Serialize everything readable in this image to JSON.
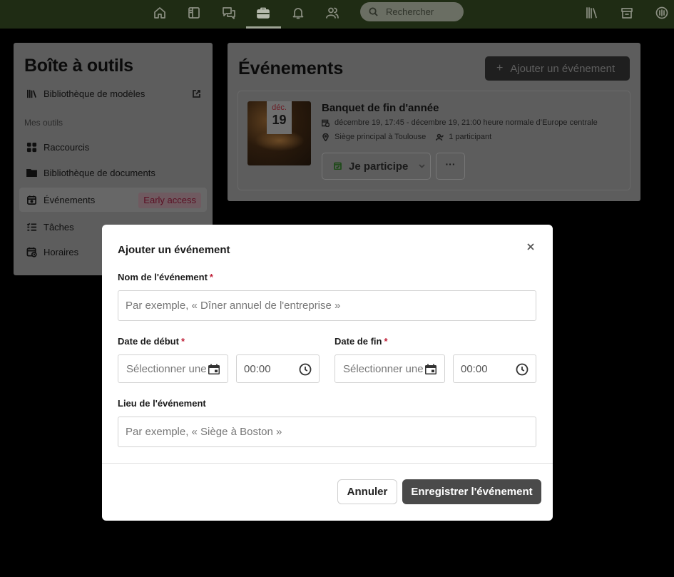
{
  "topbar": {
    "nav_icons": [
      "home-icon",
      "sidebar-icon",
      "chat-icon",
      "toolbox-icon",
      "bell-icon",
      "people-icon"
    ],
    "active_icon": "toolbox-icon",
    "search_placeholder": "Rechercher",
    "right_icons": [
      "library-icon",
      "store-icon",
      "settings-icon"
    ]
  },
  "sidebar": {
    "title": "Boîte à outils",
    "template_library": "Bibliothèque de modèles",
    "section_label": "Mes outils",
    "items": [
      {
        "label": "Raccourcis",
        "icon": "grid-icon"
      },
      {
        "label": "Bibliothèque de documents",
        "icon": "folder-icon"
      },
      {
        "label": "Événements",
        "icon": "calendar-icon",
        "badge": "Early access"
      },
      {
        "label": "Tâches",
        "icon": "checklist-icon"
      },
      {
        "label": "Horaires",
        "icon": "schedule-icon"
      }
    ]
  },
  "events": {
    "title": "Événements",
    "add_button": "Ajouter un événement",
    "card": {
      "month": "déc.",
      "day": "19",
      "name": "Banquet de fin d'année",
      "time": "décembre 19, 17:45 - décembre 19, 21:00 heure normale d’Europe centrale",
      "location": "Siège principal à Toulouse",
      "participants": "1 participant",
      "participate_button": "Je participe",
      "more_button": "···"
    }
  },
  "modal": {
    "title": "Ajouter un événement",
    "name_label": "Nom de l'événement",
    "name_placeholder": "Par exemple, « Dîner annuel de l'entreprise »",
    "start_label": "Date de début",
    "end_label": "Date de fin",
    "date_placeholder": "Sélectionner une date",
    "time_value": "00:00",
    "location_label": "Lieu de l'événement",
    "location_placeholder": "Par exemple, « Siège à Boston »",
    "required_marker": "*",
    "cancel_button": "Annuler",
    "save_button": "Enregistrer l'événement"
  },
  "colors": {
    "overlay": "#000000",
    "topbar": "#1f2c14",
    "primary_button": "#4a4a4a",
    "required": "#c0233b"
  }
}
